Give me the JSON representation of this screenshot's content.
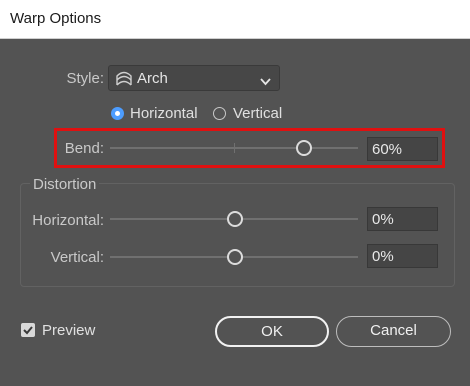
{
  "window": {
    "title": "Warp Options"
  },
  "style": {
    "label": "Style:",
    "value": "Arch",
    "icon": "arch-icon"
  },
  "orientation": {
    "options": [
      "Horizontal",
      "Vertical"
    ],
    "selected": "Horizontal"
  },
  "bend": {
    "label": "Bend:",
    "value_text": "60%",
    "level_percent": 60
  },
  "distortion": {
    "title": "Distortion",
    "horizontal": {
      "label": "Horizontal:",
      "value_text": "0%",
      "level_percent": 0
    },
    "vertical": {
      "label": "Vertical:",
      "value_text": "0%",
      "level_percent": 0
    }
  },
  "preview": {
    "label": "Preview",
    "checked": true
  },
  "buttons": {
    "ok": "OK",
    "cancel": "Cancel"
  },
  "colors": {
    "accent": "#4d9dff",
    "highlight": "#e01010",
    "dialog_bg": "#535353"
  }
}
